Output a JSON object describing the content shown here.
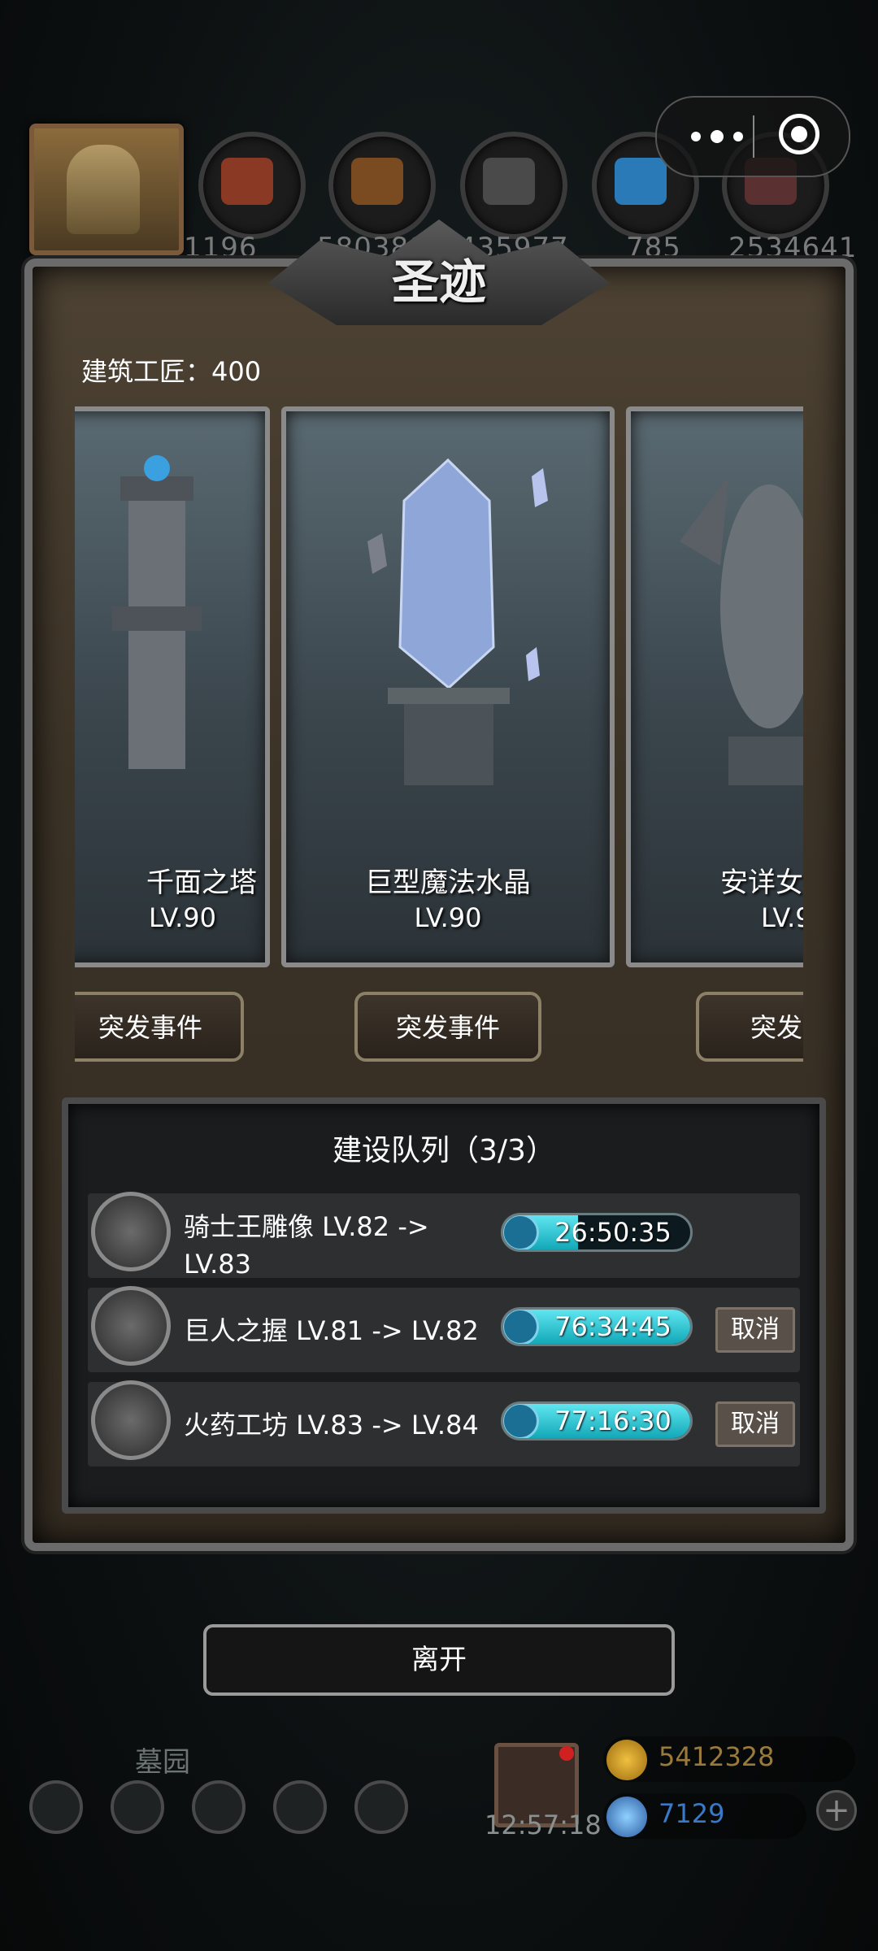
{
  "top_bar": {
    "resources": [
      {
        "name": "ore",
        "value": "1196"
      },
      {
        "name": "wood",
        "value": "580388"
      },
      {
        "name": "stone",
        "value": "435977"
      },
      {
        "name": "crystal",
        "value": "785"
      },
      {
        "name": "iron",
        "value": "2534641"
      }
    ]
  },
  "panel": {
    "title": "圣迹",
    "builder_label": "建筑工匠：400"
  },
  "buildings": [
    {
      "name": "千面之塔",
      "level": "LV.90",
      "event_label": "突发事件"
    },
    {
      "name": "巨型魔法水晶",
      "level": "LV.90",
      "event_label": "突发事件"
    },
    {
      "name": "安详女",
      "level": "LV.9",
      "event_label": "突发事"
    }
  ],
  "queue": {
    "title": "建设队列（3/3）",
    "items": [
      {
        "text": "骑士王雕像 LV.82 -> LV.83",
        "timer": "26:50:35",
        "progress": 0.4,
        "cancel": ""
      },
      {
        "text": "巨人之握 LV.81 -> LV.82",
        "timer": "76:34:45",
        "progress": 1.0,
        "cancel": "取消"
      },
      {
        "text": "火药工坊 LV.83 -> LV.84",
        "timer": "77:16:30",
        "progress": 1.0,
        "cancel": "取消"
      }
    ]
  },
  "leave_label": "离开",
  "bottom": {
    "area_name": "墓园",
    "gift_timer": "12:57:18",
    "gold": "5412328",
    "gems": "7129"
  },
  "colors": {
    "timer_fill": "#22c3d2",
    "gold_text": "#9a7a3a",
    "gem_text": "#3a78c8"
  }
}
